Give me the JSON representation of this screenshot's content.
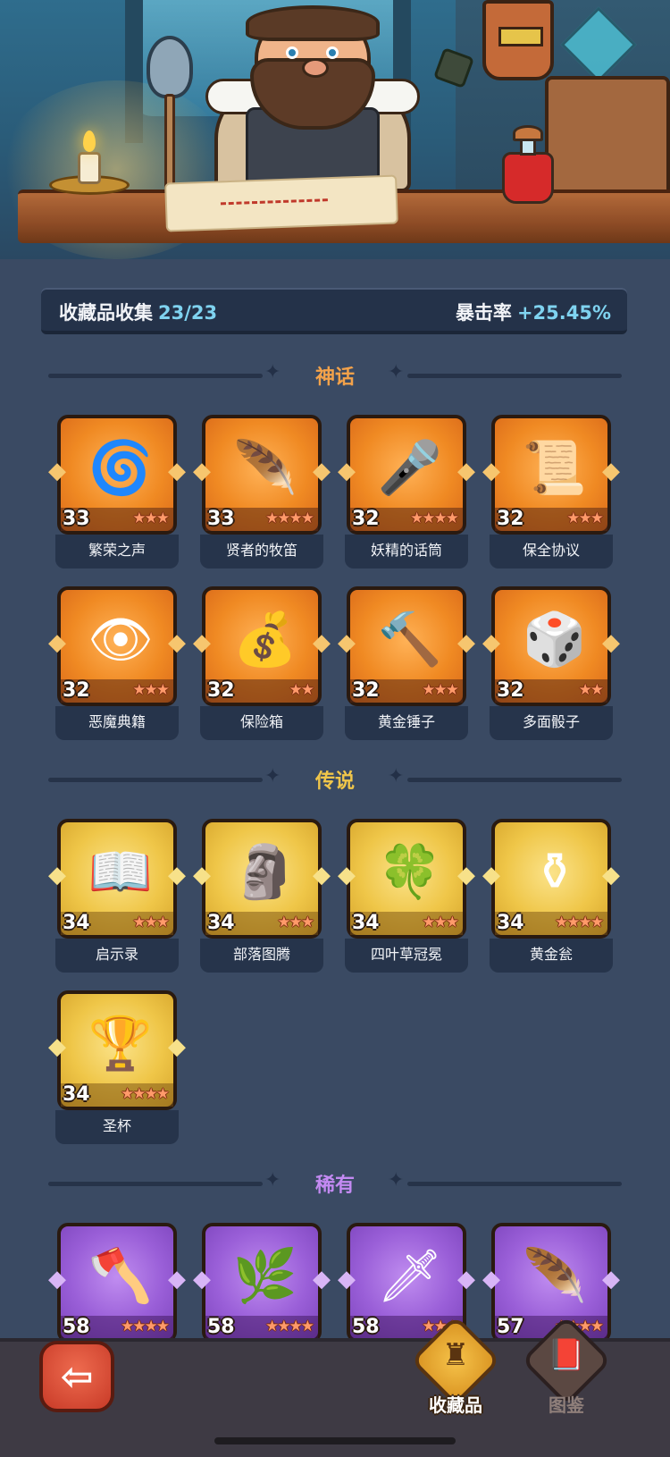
{
  "header": {
    "collection_label": "收藏品收集",
    "collection_count": "23/23",
    "crit_label": "暴击率",
    "crit_value": "+25.45%"
  },
  "sections": {
    "mythic": "神话",
    "legendary": "传说",
    "rare": "稀有"
  },
  "mythic_items": [
    {
      "name": "繁荣之声",
      "level": "33",
      "stars": "★★★",
      "icon": "🌀"
    },
    {
      "name": "贤者的牧笛",
      "level": "33",
      "stars": "★★★★",
      "icon": "🪶"
    },
    {
      "name": "妖精的话筒",
      "level": "32",
      "stars": "★★★★",
      "icon": "🎤"
    },
    {
      "name": "保全协议",
      "level": "32",
      "stars": "★★★",
      "icon": "📜"
    },
    {
      "name": "恶魔典籍",
      "level": "32",
      "stars": "★★★",
      "icon": "👁"
    },
    {
      "name": "保险箱",
      "level": "32",
      "stars": "★★",
      "icon": "💰"
    },
    {
      "name": "黄金锤子",
      "level": "32",
      "stars": "★★★",
      "icon": "🔨"
    },
    {
      "name": "多面骰子",
      "level": "32",
      "stars": "★★",
      "icon": "🎲"
    }
  ],
  "legendary_items": [
    {
      "name": "启示录",
      "level": "34",
      "stars": "★★★",
      "icon": "📖"
    },
    {
      "name": "部落图腾",
      "level": "34",
      "stars": "★★★",
      "icon": "🗿"
    },
    {
      "name": "四叶草冠冕",
      "level": "34",
      "stars": "★★★",
      "icon": "🍀"
    },
    {
      "name": "黄金瓮",
      "level": "34",
      "stars": "★★★★",
      "icon": "⚱"
    },
    {
      "name": "圣杯",
      "level": "34",
      "stars": "★★★★",
      "icon": "🏆"
    }
  ],
  "rare_items": [
    {
      "level": "58",
      "stars": "★★★★",
      "icon": "🪓"
    },
    {
      "level": "58",
      "stars": "★★★★",
      "icon": "🌿"
    },
    {
      "level": "58",
      "stars": "★★★",
      "icon": "🗡"
    },
    {
      "level": "57",
      "stars": "★★★★",
      "icon": "🪶"
    }
  ],
  "nav": {
    "back_icon": "⇦",
    "collections_label": "收藏品",
    "collections_icon": "♜",
    "codex_label": "图鉴",
    "codex_icon": "📕"
  }
}
